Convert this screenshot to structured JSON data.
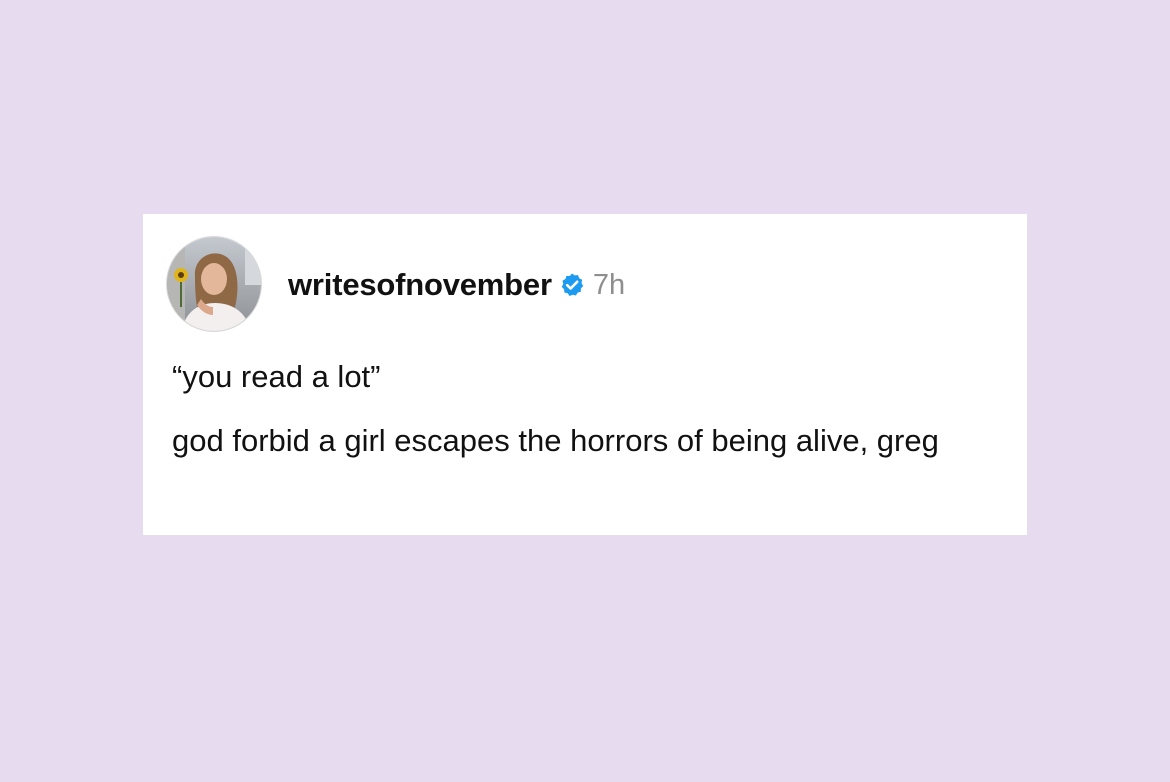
{
  "post": {
    "username": "writesofnovember",
    "verified_icon": "verified-badge-icon",
    "timestamp": "7h",
    "avatar": "profile-photo",
    "line1": "“you read a lot”",
    "line2": "god forbid a girl escapes the horrors of being alive, greg"
  },
  "colors": {
    "background": "#e7dbef",
    "card": "#ffffff",
    "verified": "#1d9bf0",
    "timestamp": "#8e8e8e",
    "text": "#111111"
  }
}
